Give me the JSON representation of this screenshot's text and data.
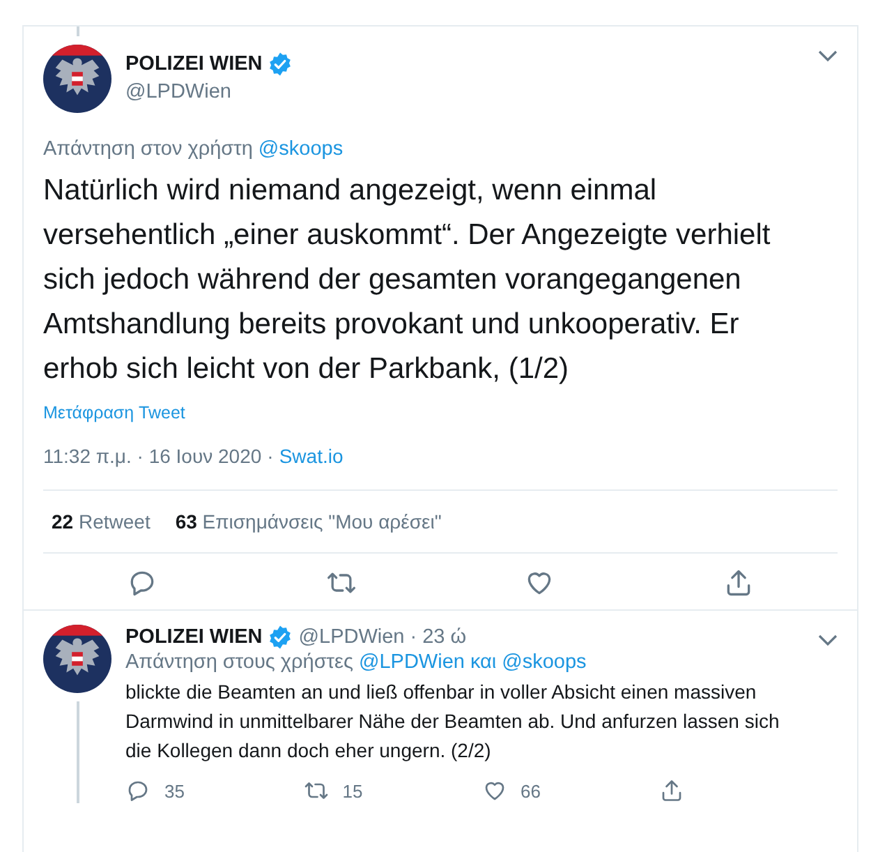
{
  "main_tweet": {
    "name": "POLIZEI WIEN",
    "verified": true,
    "handle": "@LPDWien",
    "reply_to": [
      {
        "kind": "plain",
        "text": "Απάντηση στον χρήστη"
      },
      {
        "kind": "link",
        "text": "@skoops"
      }
    ],
    "body": "Natürlich wird niemand angezeigt, wenn einmal versehentlich „einer auskommt“. Der Angezeigte verhielt sich jedoch während der gesamten vorangegangenen Amtshandlung bereits provokant und unkooperativ. Er erhob sich leicht von der Parkbank, (1/2)",
    "translate": "Μετάφραση Tweet",
    "time": "11:32 π.μ. · 16 Ιουν 2020",
    "separator": "·",
    "source": "Swat.io",
    "stats": [
      {
        "count": "22",
        "label": "Retweet"
      },
      {
        "count": "63",
        "label": "Επισημάνσεις \"Μου αρέσει\""
      }
    ],
    "actions": [
      {
        "kind": "reply"
      },
      {
        "kind": "retweet"
      },
      {
        "kind": "like"
      },
      {
        "kind": "share"
      }
    ]
  },
  "reply_tweet": {
    "name": "POLIZEI WIEN",
    "verified": true,
    "handle": "@LPDWien",
    "separator": "·",
    "time": "23 ώ",
    "reply_to": [
      {
        "kind": "plain",
        "text": "Απάντηση στους χρήστες"
      },
      {
        "kind": "link",
        "text": "@LPDWien"
      },
      {
        "kind": "link",
        "text": "και"
      },
      {
        "kind": "link",
        "text": "@skoops"
      }
    ],
    "body": "blickte die Beamten an und ließ offenbar in voller Absicht einen massiven Darmwind in unmittelbarer Nähe der Beamten ab. Und anfurzen lassen sich die Kollegen dann doch eher ungern. (2/2)",
    "actions": [
      {
        "kind": "reply",
        "count": "35"
      },
      {
        "kind": "retweet",
        "count": "15"
      },
      {
        "kind": "like",
        "count": "66"
      },
      {
        "kind": "share"
      }
    ]
  }
}
